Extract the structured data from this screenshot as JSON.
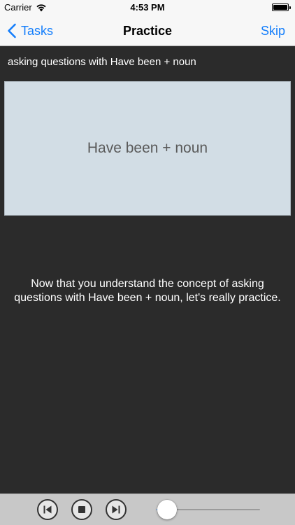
{
  "status_bar": {
    "carrier": "Carrier",
    "time": "4:53 PM",
    "wifi_icon": "wifi-icon",
    "battery_icon": "battery-icon"
  },
  "nav": {
    "back_label": "Tasks",
    "back_icon": "chevron-left-icon",
    "title": "Practice",
    "skip_label": "Skip",
    "accent_color": "#147efb"
  },
  "lesson": {
    "subtitle": "asking questions with Have been + noun",
    "card_label": "Have been + noun",
    "message": "Now that you understand the concept of asking questions with Have been + noun, let's really practice."
  },
  "player": {
    "previous_icon": "skip-back-icon",
    "stop_icon": "stop-icon",
    "next_icon": "skip-forward-icon",
    "progress_fraction": 0.1
  }
}
